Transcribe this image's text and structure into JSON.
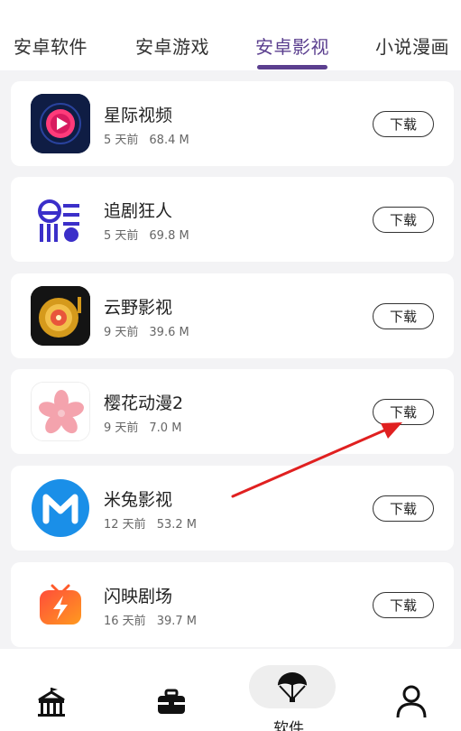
{
  "tabs": [
    {
      "label": "安卓软件"
    },
    {
      "label": "安卓游戏"
    },
    {
      "label": "安卓影视"
    },
    {
      "label": "小说漫画"
    }
  ],
  "active_tab": "安卓影视",
  "apps": [
    {
      "name": "星际视频",
      "age": "5 天前",
      "size": "68.4 M",
      "button": "下载",
      "icon": "play-icon"
    },
    {
      "name": "追剧狂人",
      "age": "5 天前",
      "size": "69.8 M",
      "button": "下载",
      "icon": "drama-logo-icon"
    },
    {
      "name": "云野影视",
      "age": "9 天前",
      "size": "39.6 M",
      "button": "下载",
      "icon": "record-player-icon"
    },
    {
      "name": "樱花动漫2",
      "age": "9 天前",
      "size": "7.0 M",
      "button": "下载",
      "icon": "sakura-flower-icon"
    },
    {
      "name": "米兔影视",
      "age": "12 天前",
      "size": "53.2 M",
      "button": "下载",
      "icon": "m-logo-icon"
    },
    {
      "name": "闪映剧场",
      "age": "16 天前",
      "size": "39.7 M",
      "button": "下载",
      "icon": "lightning-tv-icon"
    }
  ],
  "bottom_nav": {
    "items": [
      {
        "icon": "circus-tent-icon"
      },
      {
        "icon": "toolbox-icon"
      },
      {
        "icon": "parachute-icon",
        "label": "软件"
      },
      {
        "icon": "user-icon"
      }
    ]
  },
  "colors": {
    "accent": "#5b3f8f",
    "annotation_arrow": "#e02020"
  }
}
